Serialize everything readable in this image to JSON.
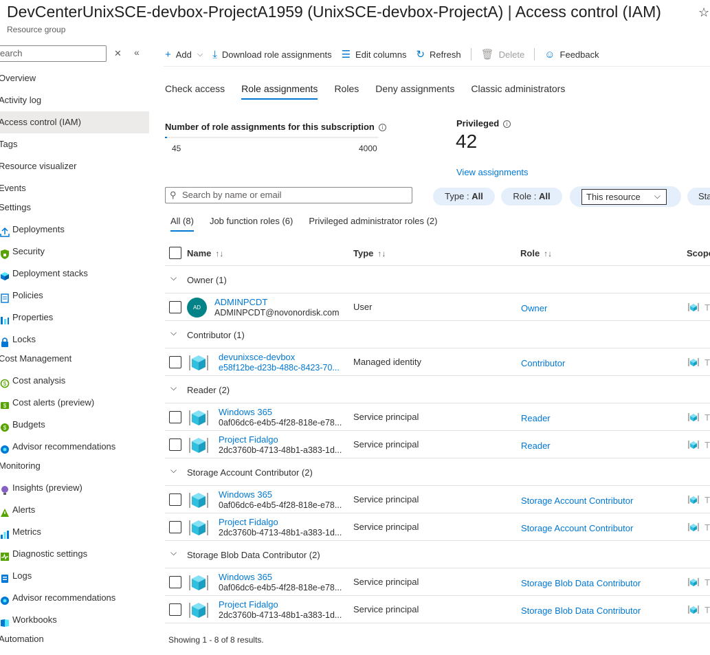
{
  "header": {
    "title": "DevCenterUnixSCE-devbox-ProjectA1959 (UnixSCE-devbox-ProjectA)",
    "separator": "|",
    "section": "Access control (IAM)",
    "subtitle": "Resource group",
    "star_icon": "star-icon"
  },
  "sidebar": {
    "search_placeholder": "earch",
    "items": [
      {
        "label": "Overview",
        "kind": "item"
      },
      {
        "label": "Activity log",
        "kind": "item"
      },
      {
        "label": "Access control (IAM)",
        "kind": "item",
        "active": true
      },
      {
        "label": "Tags",
        "kind": "item"
      },
      {
        "label": "Resource visualizer",
        "kind": "item"
      },
      {
        "label": "Events",
        "kind": "item"
      },
      {
        "label": "Settings",
        "kind": "header"
      },
      {
        "label": "Deployments",
        "kind": "sub",
        "icon": "upload-icon",
        "color": "#0078d4"
      },
      {
        "label": "Security",
        "kind": "sub",
        "icon": "lock-shield-icon",
        "color": "#57a300"
      },
      {
        "label": "Deployment stacks",
        "kind": "sub",
        "icon": "cube-stack-icon",
        "color": "#0078d4"
      },
      {
        "label": "Policies",
        "kind": "sub",
        "icon": "policy-icon",
        "color": "#0078d4"
      },
      {
        "label": "Properties",
        "kind": "sub",
        "icon": "bars-icon",
        "color": "#0078d4"
      },
      {
        "label": "Locks",
        "kind": "sub",
        "icon": "lock-icon",
        "color": "#0078d4"
      },
      {
        "label": "Cost Management",
        "kind": "header"
      },
      {
        "label": "Cost analysis",
        "kind": "sub",
        "icon": "cost-analysis-icon",
        "color": "#57a300"
      },
      {
        "label": "Cost alerts (preview)",
        "kind": "sub",
        "icon": "cost-alert-icon",
        "color": "#57a300"
      },
      {
        "label": "Budgets",
        "kind": "sub",
        "icon": "budget-icon",
        "color": "#57a300"
      },
      {
        "label": "Advisor recommendations",
        "kind": "sub",
        "icon": "advisor-icon",
        "color": "#0078d4"
      },
      {
        "label": "Monitoring",
        "kind": "header"
      },
      {
        "label": "Insights (preview)",
        "kind": "sub",
        "icon": "lightbulb-icon",
        "color": "#8661c5"
      },
      {
        "label": "Alerts",
        "kind": "sub",
        "icon": "alert-icon",
        "color": "#57a300"
      },
      {
        "label": "Metrics",
        "kind": "sub",
        "icon": "metrics-icon",
        "color": "#0078d4"
      },
      {
        "label": "Diagnostic settings",
        "kind": "sub",
        "icon": "diagnostic-icon",
        "color": "#57a300"
      },
      {
        "label": "Logs",
        "kind": "sub",
        "icon": "logs-icon",
        "color": "#0078d4"
      },
      {
        "label": "Advisor recommendations",
        "kind": "sub",
        "icon": "advisor-icon",
        "color": "#0078d4"
      },
      {
        "label": "Workbooks",
        "kind": "sub",
        "icon": "workbook-icon",
        "color": "#0078d4"
      },
      {
        "label": "Automation",
        "kind": "header"
      }
    ]
  },
  "toolbar": {
    "add": "Add",
    "download": "Download role assignments",
    "edit_columns": "Edit columns",
    "refresh": "Refresh",
    "delete": "Delete",
    "feedback": "Feedback"
  },
  "tabs": [
    "Check access",
    "Role assignments",
    "Roles",
    "Deny assignments",
    "Classic administrators"
  ],
  "active_tab": "Role assignments",
  "stats": {
    "count_label": "Number of role assignments for this subscription",
    "current": "45",
    "max": "4000",
    "usage_fraction": 0.01125,
    "privileged_label": "Privileged",
    "privileged_value": "42",
    "view_link": "View assignments"
  },
  "filters": {
    "search_placeholder": "Search by name or email",
    "type_label": "Type : ",
    "type_value": "All",
    "role_label": "Role : ",
    "role_value": "All",
    "scope_value": "This resource",
    "last_pill": "Sta"
  },
  "subtabs": [
    "All (8)",
    "Job function roles (6)",
    "Privileged administrator roles (2)"
  ],
  "table": {
    "columns": {
      "name": "Name",
      "type": "Type",
      "role": "Role",
      "scope": "Scope"
    },
    "groups": [
      {
        "title": "Owner (1)",
        "rows": [
          {
            "avatar": "AD",
            "name": "ADMINPCDT",
            "sub": "ADMINPCDT@novonordisk.com",
            "sub_link": false,
            "type": "User",
            "role": "Owner",
            "scope": "T"
          }
        ]
      },
      {
        "title": "Contributor (1)",
        "rows": [
          {
            "name": "devunixsce-devbox",
            "sub": "e58f12be-d23b-488c-8423-70...",
            "sub_link": true,
            "type": "Managed identity",
            "role": "Contributor",
            "scope": "T"
          }
        ]
      },
      {
        "title": "Reader (2)",
        "rows": [
          {
            "name": "Windows 365",
            "sub": "0af06dc6-e4b5-4f28-818e-e78...",
            "sub_link": false,
            "type": "Service principal",
            "role": "Reader",
            "scope": "T"
          },
          {
            "name": "Project Fidalgo",
            "sub": "2dc3760b-4713-48b1-a383-1d...",
            "sub_link": false,
            "type": "Service principal",
            "role": "Reader",
            "scope": "T"
          }
        ]
      },
      {
        "title": "Storage Account Contributor (2)",
        "rows": [
          {
            "name": "Windows 365",
            "sub": "0af06dc6-e4b5-4f28-818e-e78...",
            "sub_link": false,
            "type": "Service principal",
            "role": "Storage Account Contributor",
            "scope": "T"
          },
          {
            "name": "Project Fidalgo",
            "sub": "2dc3760b-4713-48b1-a383-1d...",
            "sub_link": false,
            "type": "Service principal",
            "role": "Storage Account Contributor",
            "scope": "T"
          }
        ]
      },
      {
        "title": "Storage Blob Data Contributor (2)",
        "rows": [
          {
            "name": "Windows 365",
            "sub": "0af06dc6-e4b5-4f28-818e-e78...",
            "sub_link": false,
            "type": "Service principal",
            "role": "Storage Blob Data Contributor",
            "scope": "T"
          },
          {
            "name": "Project Fidalgo",
            "sub": "2dc3760b-4713-48b1-a383-1d...",
            "sub_link": false,
            "type": "Service principal",
            "role": "Storage Blob Data Contributor",
            "scope": "T"
          }
        ]
      }
    ]
  },
  "footer": "Showing 1 - 8 of 8 results."
}
